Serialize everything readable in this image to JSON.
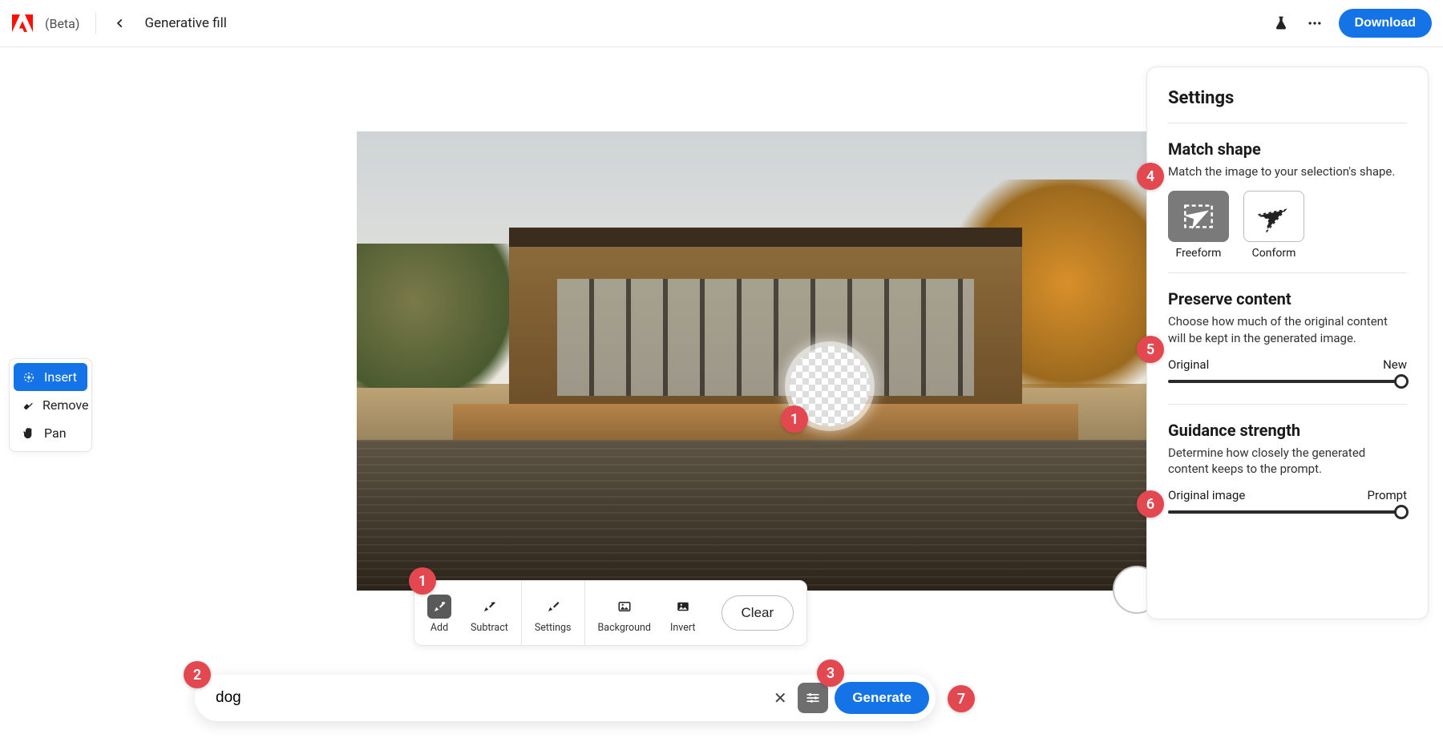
{
  "header": {
    "beta_label": "(Beta)",
    "page_title": "Generative fill",
    "download_label": "Download"
  },
  "tools": {
    "insert": "Insert",
    "remove": "Remove",
    "pan": "Pan"
  },
  "brushbar": {
    "add": "Add",
    "subtract": "Subtract",
    "settings": "Settings",
    "background": "Background",
    "invert": "Invert",
    "clear": "Clear"
  },
  "prompt": {
    "value": "dog",
    "generate": "Generate"
  },
  "settings": {
    "title": "Settings",
    "match_shape": {
      "title": "Match shape",
      "desc": "Match the image to your selection's shape.",
      "freeform": "Freeform",
      "conform": "Conform"
    },
    "preserve": {
      "title": "Preserve content",
      "desc": "Choose how much of the original content will be kept in the generated image.",
      "left": "Original",
      "right": "New"
    },
    "guidance": {
      "title": "Guidance strength",
      "desc": "Determine how closely the generated content keeps to the prompt.",
      "left": "Original image",
      "right": "Prompt"
    }
  },
  "badges": {
    "b1a": "1",
    "b1b": "1",
    "b2": "2",
    "b3": "3",
    "b4": "4",
    "b5": "5",
    "b6": "6",
    "b7": "7"
  }
}
